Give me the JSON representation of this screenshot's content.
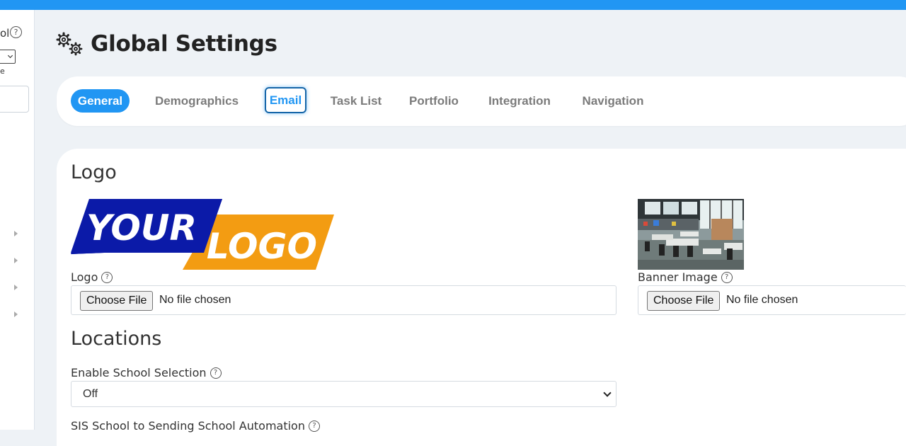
{
  "sidebar": {
    "partial_label": "ol",
    "partial_small": "e"
  },
  "header": {
    "title": "Global Settings"
  },
  "tabs": [
    {
      "label": "General"
    },
    {
      "label": "Demographics"
    },
    {
      "label": "Email"
    },
    {
      "label": "Task List"
    },
    {
      "label": "Portfolio"
    },
    {
      "label": "Integration"
    },
    {
      "label": "Navigation"
    }
  ],
  "logo_section": {
    "title": "Logo",
    "logo_image_text": [
      "YOUR",
      "LOGO"
    ],
    "logo_label": "Logo",
    "logo_file": {
      "button": "Choose File",
      "status": "No file chosen"
    },
    "banner_label": "Banner Image",
    "banner_file": {
      "button": "Choose File",
      "status": "No file chosen"
    }
  },
  "locations_section": {
    "title": "Locations",
    "school_selection_label": "Enable School Selection",
    "school_selection_value": "Off",
    "sis_automation_label": "SIS School to Sending School Automation"
  },
  "help_glyph": "?",
  "colors": {
    "accent": "#2196f3",
    "logo_blue": "#0b1aa8",
    "logo_orange": "#f39c12"
  }
}
